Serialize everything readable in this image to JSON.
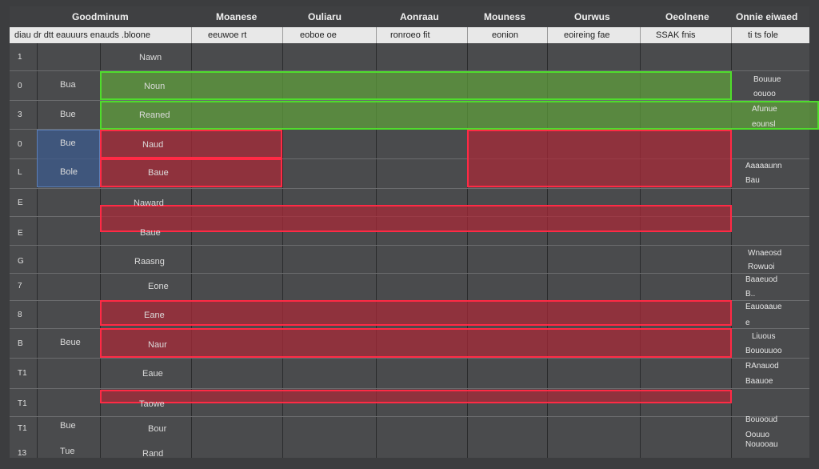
{
  "headers_top": [
    "Goodminum",
    "Moanese",
    "Ouliaru",
    "Aonraau",
    "Mouness",
    "Ourwus",
    "Oeolnene",
    "Onnie eiwaed"
  ],
  "headers_sub": [
    "diau dr dtt   eauuurs enauds .bloone",
    "eeuwoe   rt",
    "eoboe   oe",
    "ronroeo  fit",
    "eonion",
    "eoireing   fae",
    "SSAK  fnis",
    "ti  ts  fole"
  ],
  "row_numbers": [
    "1",
    "0",
    "3",
    "0",
    "L",
    "E",
    "E",
    "G",
    "7",
    "8",
    "B",
    "T1",
    "T1",
    "T1",
    "13"
  ],
  "col_b": [
    "",
    "Bua",
    "Bue",
    "Bue",
    "Bole",
    "",
    "",
    "",
    "",
    "",
    "Beue",
    "",
    "",
    "Bue",
    "Tue"
  ],
  "col_c": [
    "Nawn",
    "Noun",
    "Reaned",
    "Naud",
    "Baue",
    "Naward",
    "Baue",
    "Raasng",
    "Eone",
    "Eane",
    "Naur",
    "Eaue",
    "Taowe",
    "Bour",
    "Rand"
  ],
  "notes": {
    "r0a": "Bouuue",
    "r0b": "oouoo",
    "r1a": "Afunue",
    "r1b": "eounsl",
    "r3a": "Aaaaaunn",
    "r3b": "Bau",
    "r5a": "Wnaeosd",
    "r5b": "Rowuoi",
    "r5c": "Baaeuod",
    "r5d": "B..",
    "r7a": "Eauoaaue",
    "r7b": "e",
    "r8a": "Liuous",
    "r8b": "Bououuoo",
    "r9a": "RAnauod",
    "r9b": "Baauoe",
    "r10a": "Bouooud",
    "r10b": "Oouuo",
    "r10c": "Nouooau"
  },
  "colors": {
    "green_border": "#4fdc2c",
    "red_border": "#ff2a45",
    "blue_cell": "#3c5a8c"
  }
}
